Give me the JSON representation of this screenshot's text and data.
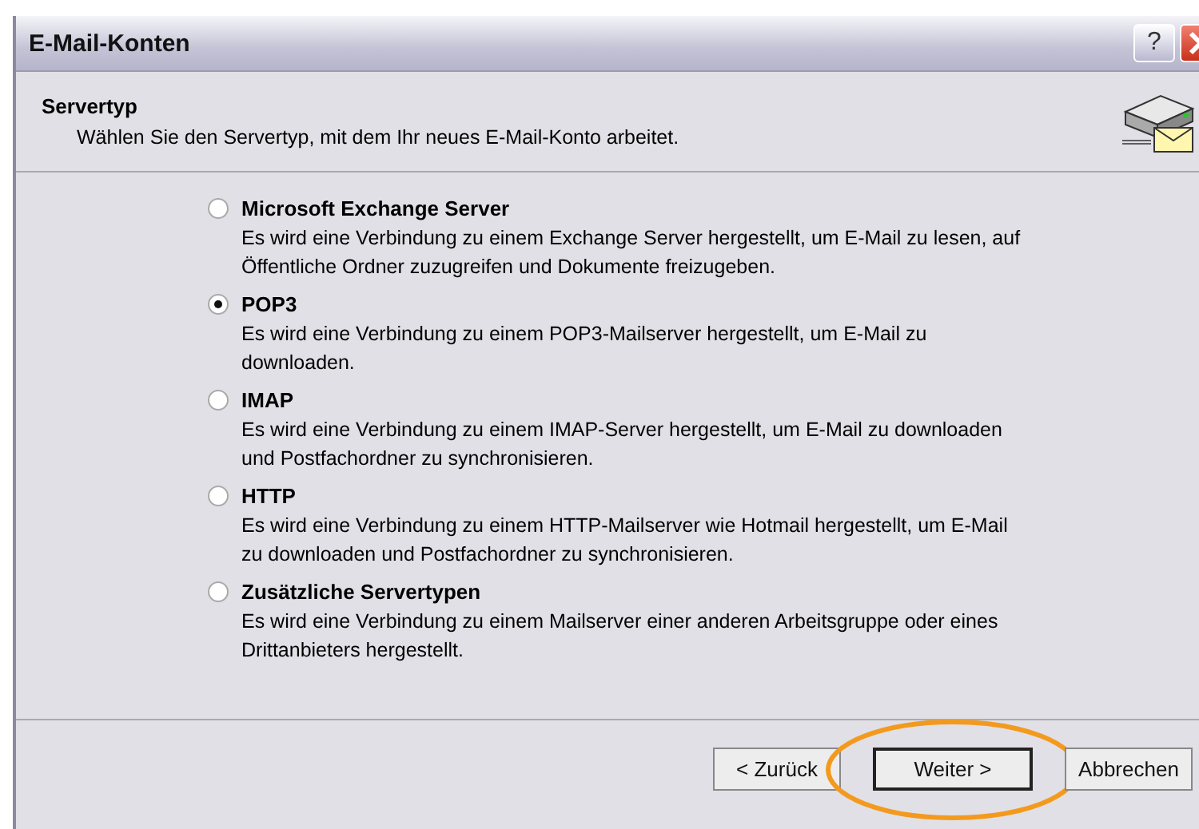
{
  "window": {
    "title": "E-Mail-Konten",
    "help_label": "?"
  },
  "header": {
    "title": "Servertyp",
    "subtitle": "Wählen Sie den Servertyp, mit dem Ihr neues E-Mail-Konto arbeitet."
  },
  "options": [
    {
      "label": "Microsoft Exchange Server",
      "description": "Es wird eine Verbindung zu einem Exchange Server hergestellt, um E-Mail zu lesen, auf Öffentliche Ordner zuzugreifen und Dokumente freizugeben.",
      "selected": false
    },
    {
      "label": "POP3",
      "description": "Es wird eine Verbindung zu einem POP3-Mailserver hergestellt, um E-Mail zu downloaden.",
      "selected": true
    },
    {
      "label": "IMAP",
      "description": "Es wird eine Verbindung zu einem IMAP-Server hergestellt, um E-Mail zu downloaden und Postfachordner zu synchronisieren.",
      "selected": false
    },
    {
      "label": "HTTP",
      "description": "Es wird eine Verbindung zu einem HTTP-Mailserver wie Hotmail hergestellt, um E-Mail zu downloaden und Postfachordner zu synchronisieren.",
      "selected": false
    },
    {
      "label": "Zusätzliche Servertypen",
      "description": "Es wird eine Verbindung zu einem Mailserver einer anderen Arbeitsgruppe oder eines Drittanbieters hergestellt.",
      "selected": false
    }
  ],
  "buttons": [
    {
      "label": "< Zurück",
      "default": false,
      "highlighted": false
    },
    {
      "label": "Weiter >",
      "default": true,
      "highlighted": true
    },
    {
      "label": "Abbrechen",
      "default": false,
      "highlighted": false
    }
  ]
}
